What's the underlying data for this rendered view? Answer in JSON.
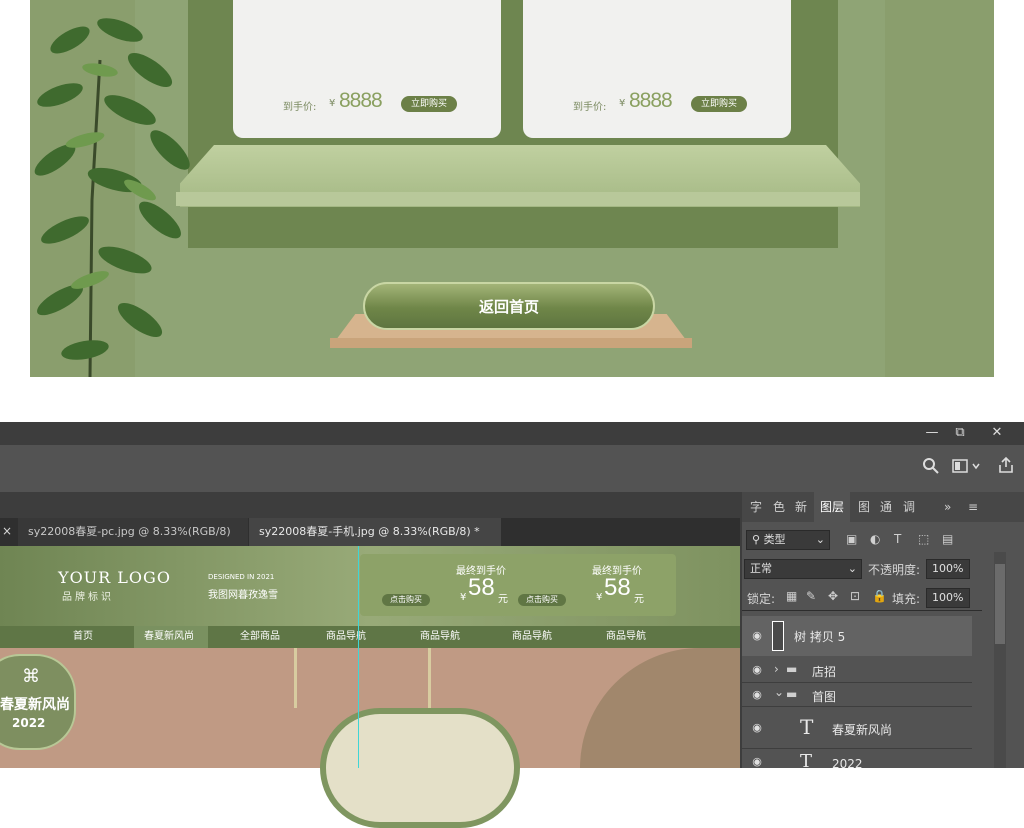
{
  "preview": {
    "cards": [
      {
        "price_label": "到手价:",
        "currency": "¥",
        "price": "8888",
        "buy_label": "立即购买"
      },
      {
        "price_label": "到手价:",
        "currency": "¥",
        "price": "8888",
        "buy_label": "立即购买"
      }
    ],
    "back_button": "返回首页"
  },
  "photoshop": {
    "window_controls": {
      "minimize": "—",
      "restore": "⧉",
      "close": "✕"
    },
    "options": {
      "search_icon": "search-icon",
      "view_icon": "view-icon",
      "share_icon": "share-icon"
    },
    "tabs": [
      {
        "label": "sy22008春夏-pc.jpg @ 8.33%(RGB/8)",
        "close": "×"
      },
      {
        "label": "sy22008春夏-手机.jpg @ 8.33%(RGB/8) *",
        "close": "×"
      }
    ],
    "tab_close_first": "×",
    "canvas": {
      "logo": "YOUR LOGO",
      "logo_sub": "品牌标识",
      "designed": "DESIGNED IN 2021",
      "tagline": "我图网暮孜逸雪",
      "coupons": [
        {
          "title": "最终到手价",
          "currency": "¥",
          "amount": "58",
          "unit": "元",
          "btn": "点击购买"
        },
        {
          "title": "最终到手价",
          "currency": "¥",
          "amount": "58",
          "unit": "元",
          "btn": "点击购买"
        }
      ],
      "nav": [
        "首页",
        "春夏新风尚",
        "全部商品",
        "商品导航",
        "商品导航",
        "商品导航",
        "商品导航"
      ],
      "badge_text": "春夏新风尚",
      "badge_year": "2022"
    },
    "panel": {
      "tabs": [
        "字",
        "色",
        "新",
        "图层",
        "图",
        "通",
        "调"
      ],
      "filter": "类型",
      "blend": "正常",
      "opacity_label": "不透明度:",
      "opacity": "100%",
      "lock_label": "锁定:",
      "fill_label": "填充:",
      "fill": "100%",
      "layers": [
        {
          "name": "树 拷贝 5",
          "type": "image"
        },
        {
          "name": "店招",
          "type": "group"
        },
        {
          "name": "首图",
          "type": "group"
        },
        {
          "name": "春夏新风尚",
          "type": "text"
        },
        {
          "name": "2022",
          "type": "text"
        }
      ]
    }
  },
  "colors": {
    "accent": "#6c8047",
    "ps_bg": "#3d3d3d",
    "guide": "#3fd6d6"
  }
}
